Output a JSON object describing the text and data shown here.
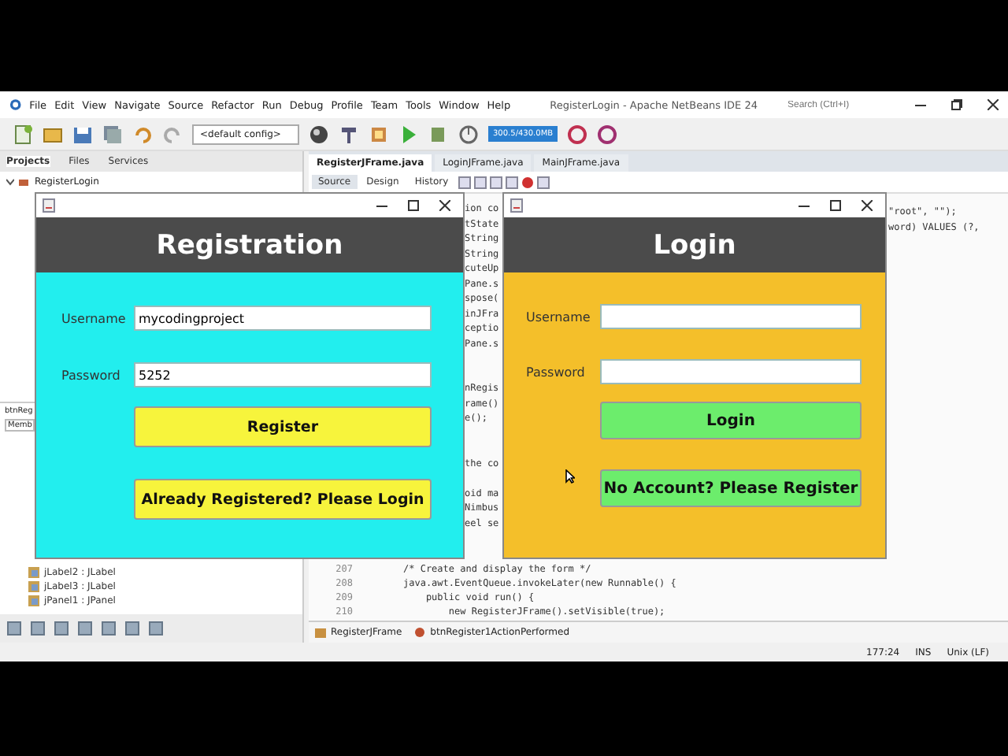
{
  "ide": {
    "title": "RegisterLogin - Apache NetBeans IDE 24",
    "menu": [
      "File",
      "Edit",
      "View",
      "Navigate",
      "Source",
      "Refactor",
      "Run",
      "Debug",
      "Profile",
      "Team",
      "Tools",
      "Window",
      "Help"
    ],
    "search": {
      "placeholder": "Search (Ctrl+I)"
    },
    "config": "<default config>",
    "memory": {
      "text": "300.5/430.0MB",
      "level": 1
    },
    "panel_tabs": [
      {
        "label": "Projects",
        "selected": true
      },
      {
        "label": "Files",
        "selected": false
      },
      {
        "label": "Services",
        "selected": false
      }
    ],
    "project_tree": [
      {
        "label": "RegisterLogin",
        "expanded": true
      }
    ],
    "navigator": {
      "title": "btnReg",
      "filter": "Memb",
      "items": [
        "jLabel2 : JLabel",
        "jLabel3 : JLabel",
        "jPanel1 : JPanel"
      ]
    },
    "editor_tabs": [
      {
        "label": "RegisterJFrame.java",
        "selected": true
      },
      {
        "label": "LoginJFrame.java",
        "selected": false
      },
      {
        "label": "MainJFrame.java",
        "selected": false
      }
    ],
    "views": [
      {
        "label": "Source",
        "selected": true
      },
      {
        "label": "Design",
        "selected": false
      },
      {
        "label": "History",
        "selected": false
      }
    ],
    "code": {
      "middle": [
        [
          "ion co",
          "tState",
          "String",
          "String",
          "cuteUp",
          "Pane.s",
          "spose(",
          "inJFra",
          "ceptio",
          "Pane.s"
        ],
        [
          "nRegis",
          "rame()",
          "e();"
        ],
        [
          "the co"
        ],
        [
          "oid ma",
          "Nimbus",
          "eel se"
        ]
      ],
      "right": [
        "\"root\", \"\");",
        "word) VALUES (?,"
      ],
      "lines": [
        {
          "number": "207",
          "text": "/* Create and display the form */"
        },
        {
          "number": "208",
          "text": "java.awt.EventQueue.invokeLater(new Runnable() {"
        },
        {
          "number": "209",
          "text": "    public void run() {"
        },
        {
          "number": "210",
          "text": "        new RegisterJFrame().setVisible(true);"
        }
      ]
    },
    "breadcrumb": [
      "RegisterJFrame",
      "btnRegister1ActionPerformed"
    ],
    "status": {
      "position": "177:24",
      "mode": "INS",
      "line_ending": "Unix (LF)"
    }
  },
  "windows": [
    {
      "kind": "register",
      "title": "Registration",
      "color": "#22eeee",
      "fields": [
        {
          "label": "Username",
          "value": "mycodingproject"
        },
        {
          "label": "Password",
          "value": "5252"
        }
      ],
      "buttons": [
        {
          "label": "Register",
          "color": "#f7f43c"
        },
        {
          "label": "Already Registered? Please Login",
          "color": "#f7f43c"
        }
      ]
    },
    {
      "kind": "login",
      "title": "Login",
      "color": "#f4bf2a",
      "fields": [
        {
          "label": "Username"
        },
        {
          "label": "Password"
        }
      ],
      "buttons": [
        {
          "label": "Login",
          "color": "#6ced6c"
        },
        {
          "label": "No Account? Please Register",
          "color": "#6ced6c"
        }
      ]
    }
  ]
}
